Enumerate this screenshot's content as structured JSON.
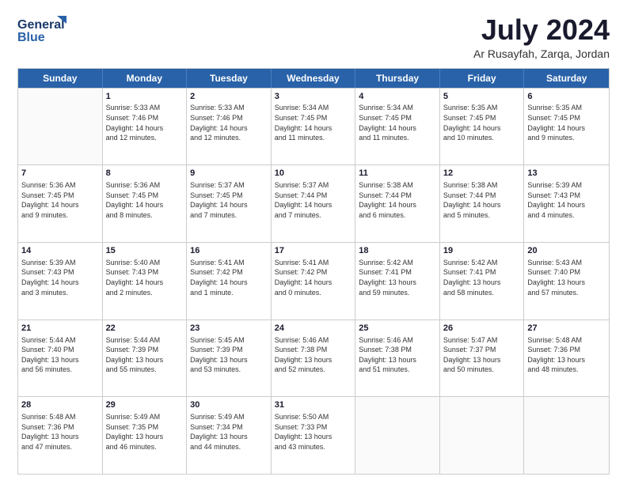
{
  "logo": {
    "line1": "General",
    "line2": "Blue"
  },
  "title": "July 2024",
  "location": "Ar Rusayfah, Zarqa, Jordan",
  "days_header": [
    "Sunday",
    "Monday",
    "Tuesday",
    "Wednesday",
    "Thursday",
    "Friday",
    "Saturday"
  ],
  "weeks": [
    [
      {
        "day": "",
        "info": ""
      },
      {
        "day": "1",
        "info": "Sunrise: 5:33 AM\nSunset: 7:46 PM\nDaylight: 14 hours\nand 12 minutes."
      },
      {
        "day": "2",
        "info": "Sunrise: 5:33 AM\nSunset: 7:46 PM\nDaylight: 14 hours\nand 12 minutes."
      },
      {
        "day": "3",
        "info": "Sunrise: 5:34 AM\nSunset: 7:45 PM\nDaylight: 14 hours\nand 11 minutes."
      },
      {
        "day": "4",
        "info": "Sunrise: 5:34 AM\nSunset: 7:45 PM\nDaylight: 14 hours\nand 11 minutes."
      },
      {
        "day": "5",
        "info": "Sunrise: 5:35 AM\nSunset: 7:45 PM\nDaylight: 14 hours\nand 10 minutes."
      },
      {
        "day": "6",
        "info": "Sunrise: 5:35 AM\nSunset: 7:45 PM\nDaylight: 14 hours\nand 9 minutes."
      }
    ],
    [
      {
        "day": "7",
        "info": "Sunrise: 5:36 AM\nSunset: 7:45 PM\nDaylight: 14 hours\nand 9 minutes."
      },
      {
        "day": "8",
        "info": "Sunrise: 5:36 AM\nSunset: 7:45 PM\nDaylight: 14 hours\nand 8 minutes."
      },
      {
        "day": "9",
        "info": "Sunrise: 5:37 AM\nSunset: 7:45 PM\nDaylight: 14 hours\nand 7 minutes."
      },
      {
        "day": "10",
        "info": "Sunrise: 5:37 AM\nSunset: 7:44 PM\nDaylight: 14 hours\nand 7 minutes."
      },
      {
        "day": "11",
        "info": "Sunrise: 5:38 AM\nSunset: 7:44 PM\nDaylight: 14 hours\nand 6 minutes."
      },
      {
        "day": "12",
        "info": "Sunrise: 5:38 AM\nSunset: 7:44 PM\nDaylight: 14 hours\nand 5 minutes."
      },
      {
        "day": "13",
        "info": "Sunrise: 5:39 AM\nSunset: 7:43 PM\nDaylight: 14 hours\nand 4 minutes."
      }
    ],
    [
      {
        "day": "14",
        "info": "Sunrise: 5:39 AM\nSunset: 7:43 PM\nDaylight: 14 hours\nand 3 minutes."
      },
      {
        "day": "15",
        "info": "Sunrise: 5:40 AM\nSunset: 7:43 PM\nDaylight: 14 hours\nand 2 minutes."
      },
      {
        "day": "16",
        "info": "Sunrise: 5:41 AM\nSunset: 7:42 PM\nDaylight: 14 hours\nand 1 minute."
      },
      {
        "day": "17",
        "info": "Sunrise: 5:41 AM\nSunset: 7:42 PM\nDaylight: 14 hours\nand 0 minutes."
      },
      {
        "day": "18",
        "info": "Sunrise: 5:42 AM\nSunset: 7:41 PM\nDaylight: 13 hours\nand 59 minutes."
      },
      {
        "day": "19",
        "info": "Sunrise: 5:42 AM\nSunset: 7:41 PM\nDaylight: 13 hours\nand 58 minutes."
      },
      {
        "day": "20",
        "info": "Sunrise: 5:43 AM\nSunset: 7:40 PM\nDaylight: 13 hours\nand 57 minutes."
      }
    ],
    [
      {
        "day": "21",
        "info": "Sunrise: 5:44 AM\nSunset: 7:40 PM\nDaylight: 13 hours\nand 56 minutes."
      },
      {
        "day": "22",
        "info": "Sunrise: 5:44 AM\nSunset: 7:39 PM\nDaylight: 13 hours\nand 55 minutes."
      },
      {
        "day": "23",
        "info": "Sunrise: 5:45 AM\nSunset: 7:39 PM\nDaylight: 13 hours\nand 53 minutes."
      },
      {
        "day": "24",
        "info": "Sunrise: 5:46 AM\nSunset: 7:38 PM\nDaylight: 13 hours\nand 52 minutes."
      },
      {
        "day": "25",
        "info": "Sunrise: 5:46 AM\nSunset: 7:38 PM\nDaylight: 13 hours\nand 51 minutes."
      },
      {
        "day": "26",
        "info": "Sunrise: 5:47 AM\nSunset: 7:37 PM\nDaylight: 13 hours\nand 50 minutes."
      },
      {
        "day": "27",
        "info": "Sunrise: 5:48 AM\nSunset: 7:36 PM\nDaylight: 13 hours\nand 48 minutes."
      }
    ],
    [
      {
        "day": "28",
        "info": "Sunrise: 5:48 AM\nSunset: 7:36 PM\nDaylight: 13 hours\nand 47 minutes."
      },
      {
        "day": "29",
        "info": "Sunrise: 5:49 AM\nSunset: 7:35 PM\nDaylight: 13 hours\nand 46 minutes."
      },
      {
        "day": "30",
        "info": "Sunrise: 5:49 AM\nSunset: 7:34 PM\nDaylight: 13 hours\nand 44 minutes."
      },
      {
        "day": "31",
        "info": "Sunrise: 5:50 AM\nSunset: 7:33 PM\nDaylight: 13 hours\nand 43 minutes."
      },
      {
        "day": "",
        "info": ""
      },
      {
        "day": "",
        "info": ""
      },
      {
        "day": "",
        "info": ""
      }
    ]
  ]
}
